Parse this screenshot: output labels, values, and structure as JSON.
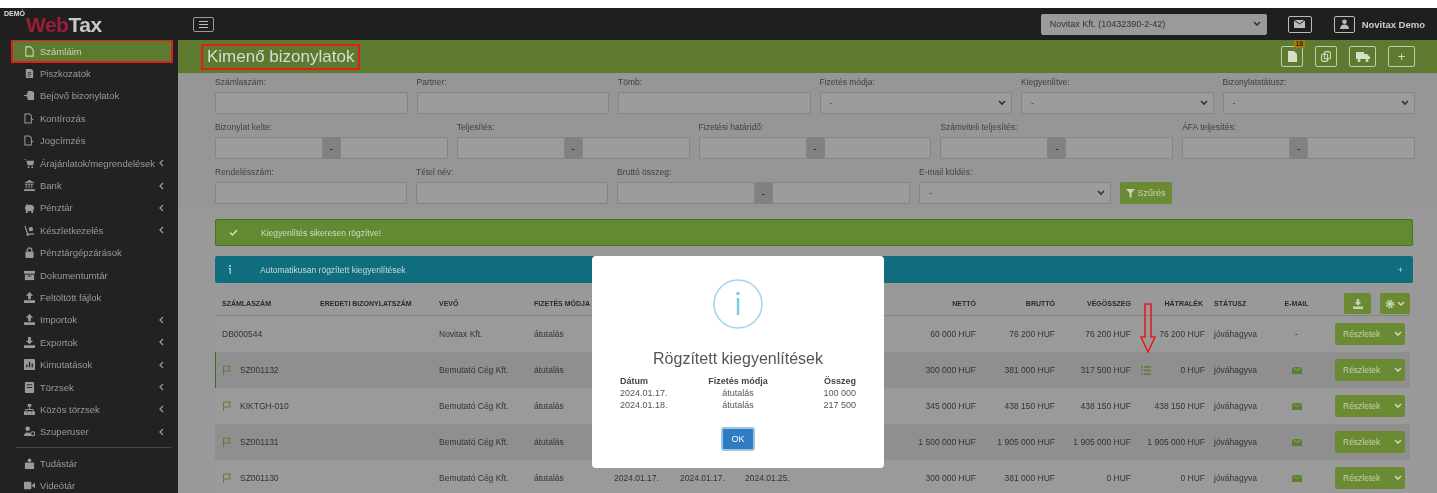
{
  "header": {
    "logo_tag": "DEMÓ",
    "logo_first": "Web",
    "logo_second": "Tax",
    "company_select": "Novitax Kft. (10432390-2-42)",
    "user_name": "Novitax Demo"
  },
  "sidebar": {
    "items": [
      {
        "label": "Számláim",
        "selected": true,
        "highlighted": true,
        "submenu": false
      },
      {
        "label": "Piszkozatok",
        "selected": false,
        "highlighted": false,
        "submenu": false
      },
      {
        "label": "Bejövő bizonylatok",
        "selected": false,
        "highlighted": false,
        "submenu": false
      },
      {
        "label": "Kontírozás",
        "selected": false,
        "highlighted": false,
        "submenu": false
      },
      {
        "label": "Jogcímzés",
        "selected": false,
        "highlighted": false,
        "submenu": false
      },
      {
        "label": "Árajánlatok/megrendelések",
        "selected": false,
        "highlighted": false,
        "submenu": true
      },
      {
        "label": "Bank",
        "selected": false,
        "highlighted": false,
        "submenu": true
      },
      {
        "label": "Pénztár",
        "selected": false,
        "highlighted": false,
        "submenu": true
      },
      {
        "label": "Készletkezelés",
        "selected": false,
        "highlighted": false,
        "submenu": true
      },
      {
        "label": "Pénztárgépzárások",
        "selected": false,
        "highlighted": false,
        "submenu": false
      },
      {
        "label": "Dokumentumtár",
        "selected": false,
        "highlighted": false,
        "submenu": false
      },
      {
        "label": "Feltöltött fájlok",
        "selected": false,
        "highlighted": false,
        "submenu": false
      },
      {
        "label": "Importok",
        "selected": false,
        "highlighted": false,
        "submenu": true
      },
      {
        "label": "Exportok",
        "selected": false,
        "highlighted": false,
        "submenu": true
      },
      {
        "label": "Kimutatások",
        "selected": false,
        "highlighted": false,
        "submenu": true
      },
      {
        "label": "Törzsek",
        "selected": false,
        "highlighted": false,
        "submenu": true
      },
      {
        "label": "Közös törzsek",
        "selected": false,
        "highlighted": false,
        "submenu": true
      },
      {
        "label": "Szuperuser",
        "selected": false,
        "highlighted": false,
        "submenu": true
      }
    ],
    "footer_items": [
      {
        "label": "Tudástár",
        "selected": false,
        "highlighted": false,
        "submenu": false
      },
      {
        "label": "Videótár",
        "selected": false,
        "highlighted": false,
        "submenu": false
      }
    ]
  },
  "page_title": {
    "text": "Kimenő bizonylatok",
    "highlighted": true
  },
  "toolbar": {
    "badge": "18",
    "add": "+"
  },
  "filters": {
    "fields": [
      {
        "kind": "text",
        "label": "Számlaszám:"
      },
      {
        "kind": "text",
        "label": "Partner:"
      },
      {
        "kind": "text",
        "label": "Tömb:"
      },
      {
        "kind": "select",
        "label": "Fizetés módja:",
        "value": "-"
      },
      {
        "kind": "select",
        "label": "Kiegyenlítve:",
        "value": "-"
      },
      {
        "kind": "select",
        "label": "Bizonylatstátusz:",
        "value": "-"
      },
      {
        "kind": "range",
        "label": "Bizonylat kelte:",
        "separator": "-"
      },
      {
        "kind": "range",
        "label": "Teljesítés:",
        "separator": "-"
      },
      {
        "kind": "range",
        "label": "Fizetési határidő:",
        "separator": "-"
      },
      {
        "kind": "range",
        "label": "Számviteli teljesítés:",
        "separator": "-"
      },
      {
        "kind": "range",
        "label": "ÁFA teljesítés:",
        "separator": "-"
      },
      {
        "kind": "text",
        "label": "Rendelésszám:"
      },
      {
        "kind": "text",
        "label": "Tétel név:"
      },
      {
        "kind": "range",
        "label": "Bruttó összeg:",
        "separator": "-"
      },
      {
        "kind": "select",
        "label": "E-mail küldés:",
        "value": "-"
      }
    ],
    "button": "Szűrés"
  },
  "alerts": [
    {
      "kind": "success",
      "text": "Kiegyenlítés sikeresen rögzítve!"
    },
    {
      "kind": "info",
      "text": "Automatikusan rögzített kiegyenlítések",
      "action": "+"
    }
  ],
  "table": {
    "columns": [
      "SZÁMLASZÁM",
      "EREDETI BIZONYLATSZÁM",
      "VEVŐ",
      "FIZETÉS MÓDJA",
      "NETTÓ",
      "BRUTTÓ",
      "VÉGÖSSZEG",
      "HÁTRALÉK",
      "STÁTUSZ",
      "E-MAIL"
    ],
    "rows": [
      {
        "number": "DB000544",
        "flag": false,
        "selected": false,
        "buyer": "Novitax Kft.",
        "payment": "átutalás",
        "net": "60 000 HUF",
        "gross": "76 200 HUF",
        "total": "76 200 HUF",
        "settlements": false,
        "balance": "76 200 HUF",
        "status": "jóváhagyva",
        "email_sent": false,
        "email_text": "-",
        "action": "Részletek"
      },
      {
        "number": "SZ001132",
        "flag": true,
        "selected": true,
        "buyer": "Bemutató Cég Kft.",
        "payment": "átutalás",
        "net": "300 000 HUF",
        "gross": "381 000 HUF",
        "total": "317 500 HUF",
        "settlements": true,
        "balance": "0 HUF",
        "status": "jóváhagyva",
        "email_sent": true,
        "action": "Részletek"
      },
      {
        "number": "KIKTGH-010",
        "flag": true,
        "selected": false,
        "buyer": "Bemutató Cég Kft.",
        "payment": "átutalás",
        "net": "345 000 HUF",
        "gross": "438 150 HUF",
        "total": "438 150 HUF",
        "settlements": false,
        "balance": "438 150 HUF",
        "status": "jóváhagyva",
        "email_sent": true,
        "action": "Részletek"
      },
      {
        "number": "SZ001131",
        "flag": true,
        "selected": false,
        "buyer": "Bemutató Cég Kft.",
        "payment": "átutalás",
        "net": "1 500 000 HUF",
        "gross": "1 905 000 HUF",
        "total": "1 905 000 HUF",
        "settlements": false,
        "balance": "1 905 000 HUF",
        "status": "jóváhagyva",
        "email_sent": true,
        "action": "Részletek"
      },
      {
        "number": "SZ001130",
        "flag": true,
        "selected": false,
        "buyer": "Bemutató Cég Kft.",
        "payment": "átutalás",
        "dates": [
          "2024.01.17.",
          "2024.01.17.",
          "2024.01.25."
        ],
        "net": "300 000 HUF",
        "gross": "381 000 HUF",
        "total": "0 HUF",
        "settlements": false,
        "balance": "0 HUF",
        "status": "jóváhagyva",
        "email_sent": true,
        "action": "Részletek"
      }
    ]
  },
  "modal": {
    "title": "Rögzített kiegyenlítések",
    "columns": [
      "Dátum",
      "Fizetés módja",
      "Összeg"
    ],
    "rows": [
      [
        "2024.01.17.",
        "átutalás",
        "100 000"
      ],
      [
        "2024.01.18.",
        "átutalás",
        "217 500"
      ]
    ],
    "button": "OK"
  }
}
